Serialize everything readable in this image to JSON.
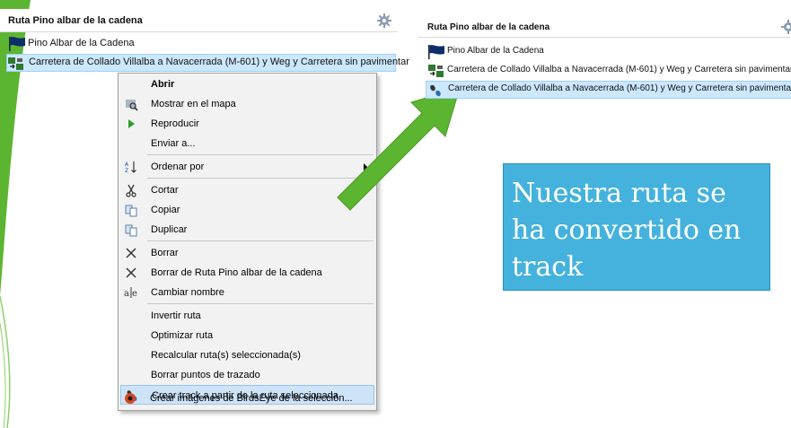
{
  "left_panel": {
    "title": "Ruta Pino albar de la cadena",
    "items": [
      {
        "label": "Pino Albar de la Cadena",
        "icon": "flag-icon"
      },
      {
        "label": "Carretera de Collado Villalba a Navacerrada (M-601) y Weg y Carretera sin pavimentar",
        "icon": "route-icon"
      }
    ]
  },
  "context_menu": {
    "items": [
      {
        "label": "Abrir",
        "icon": "",
        "bold": true
      },
      {
        "label": "Mostrar en el mapa",
        "icon": "map-icon"
      },
      {
        "label": "Reproducir",
        "icon": "play-icon"
      },
      {
        "label": "Enviar a...",
        "icon": ""
      },
      {
        "label": "Ordenar por",
        "icon": "sort-icon",
        "submenu": true
      },
      {
        "label": "Cortar",
        "icon": "scissors-icon"
      },
      {
        "label": "Copiar",
        "icon": "copy-icon"
      },
      {
        "label": "Duplicar",
        "icon": "duplicate-icon"
      },
      {
        "label": "Borrar",
        "icon": "delete-icon"
      },
      {
        "label": "Borrar de Ruta Pino albar de la cadena",
        "icon": "delete-icon"
      },
      {
        "label": "Cambiar nombre",
        "icon": "rename-icon"
      },
      {
        "label": "Invertir ruta",
        "icon": ""
      },
      {
        "label": "Optimizar ruta",
        "icon": ""
      },
      {
        "label": "Recalcular ruta(s) seleccionada(s)",
        "icon": ""
      },
      {
        "label": "Borrar puntos de trazado",
        "icon": ""
      },
      {
        "label": "Crear track a partir de la ruta seleccionada",
        "icon": "track-icon",
        "highlighted": true
      },
      {
        "label": "Crear imágenes de BirdsEye de la selección...",
        "icon": "birdseye-icon"
      }
    ]
  },
  "right_panel": {
    "title": "Ruta Pino albar de la cadena",
    "items": [
      {
        "label": "Pino Albar de la Cadena",
        "icon": "flag-icon"
      },
      {
        "label": "Carretera de Collado Villalba a Navacerrada (M-601) y Weg y Carretera sin pavimentar",
        "icon": "route-icon"
      },
      {
        "label": "Carretera de Collado Villalba a Navacerrada (M-601) y Weg y Carretera sin pavimentar",
        "icon": "track-icon"
      }
    ]
  },
  "callout": {
    "text": "Nuestra ruta se ha convertido en track"
  },
  "colors": {
    "accent_green": "#5cb531",
    "callout_blue": "#44b2dd",
    "selection_blue": "#cce8ff",
    "menu_background": "#f2f2f2"
  }
}
